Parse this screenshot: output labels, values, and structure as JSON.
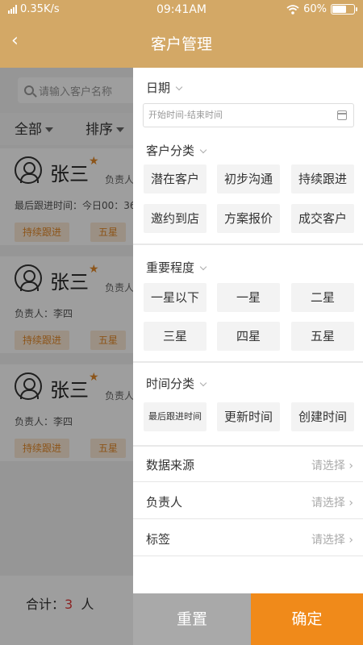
{
  "status": {
    "network": "0.35K/s",
    "time": "09:41AM",
    "battery": "60%"
  },
  "nav": {
    "back_icon": "chevron-left-icon",
    "title": "客户管理"
  },
  "page": {
    "search_placeholder": "请输入客户名称",
    "filter_all": "全部",
    "filter_sort": "排序",
    "customers": [
      {
        "name": "张三",
        "owner_right": "负责人",
        "line": "最后跟进时间：今日00：36",
        "tags": [
          "持续跟进",
          "五星"
        ]
      },
      {
        "name": "张三",
        "owner_right": "负责人",
        "line": "负责人：李四",
        "tags": [
          "持续跟进",
          "五星"
        ]
      },
      {
        "name": "张三",
        "owner_right": "负责人",
        "line": "负责人：李四",
        "tags": [
          "持续跟进",
          "五星"
        ]
      }
    ],
    "total_label": "合计：",
    "total_count": "3",
    "total_unit": "人"
  },
  "drawer": {
    "date": {
      "title": "日期",
      "placeholder": "开始时间-结束时间"
    },
    "category": {
      "title": "客户分类",
      "options": [
        "潜在客户",
        "初步沟通",
        "持续跟进",
        "邀约到店",
        "方案报价",
        "成交客户"
      ]
    },
    "importance": {
      "title": "重要程度",
      "options": [
        "一星以下",
        "一星",
        "二星",
        "三星",
        "四星",
        "五星"
      ]
    },
    "time_category": {
      "title": "时间分类",
      "options": [
        "最后跟进时间",
        "更新时间",
        "创建时间"
      ]
    },
    "rows": [
      {
        "label": "数据来源",
        "value": "请选择"
      },
      {
        "label": "负责人",
        "value": "请选择"
      },
      {
        "label": "标签",
        "value": "请选择"
      }
    ],
    "reset": "重置",
    "confirm": "确定"
  },
  "colors": {
    "header": "#d3a866",
    "accent": "#f08a1a",
    "reset": "#a9a9a9",
    "tag_text": "#e2892a"
  }
}
